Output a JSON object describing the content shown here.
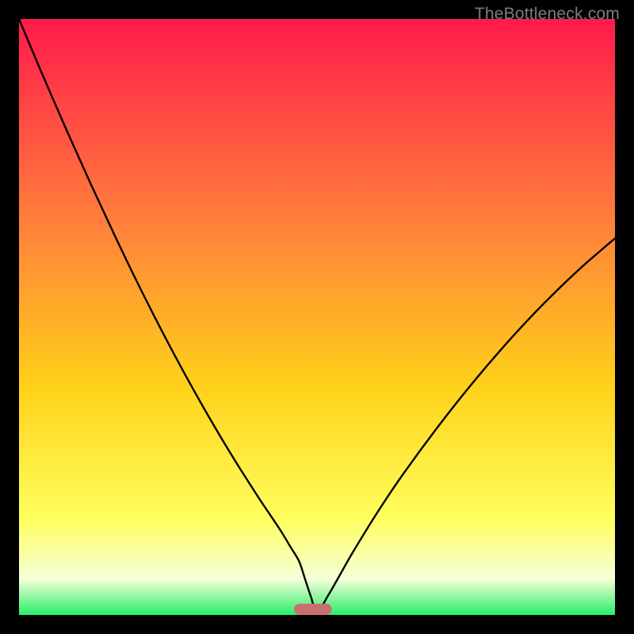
{
  "watermark": "TheBottleneck.com",
  "colors": {
    "gradient_top": "#ff1a4b",
    "gradient_upper_mid": "#ff823a",
    "gradient_mid": "#ffd21a",
    "gradient_lower_mid": "#ffff60",
    "gradient_low": "#f5ffd8",
    "gradient_bottom": "#29ee6a",
    "curve": "#000000",
    "marker_fill": "#c96f6f",
    "frame": "#000000"
  },
  "chart_data": {
    "type": "line",
    "title": "",
    "xlabel": "",
    "ylabel": "",
    "xlim": [
      0,
      100
    ],
    "ylim": [
      0,
      100
    ],
    "grid": false,
    "legend": false,
    "annotations": [],
    "series": [
      {
        "name": "curve",
        "x": [
          0,
          4,
          8,
          12,
          16,
          20,
          24,
          28,
          32,
          36,
          40,
          42,
          44,
          45.5,
          47,
          48,
          49,
          50,
          52,
          54,
          56,
          60,
          64,
          70,
          76,
          82,
          88,
          94,
          100
        ],
        "y": [
          100,
          90.5,
          81.3,
          72.4,
          63.8,
          55.5,
          47.6,
          40.1,
          33.0,
          26.3,
          20.0,
          17.0,
          14.0,
          11.5,
          9.0,
          6.0,
          3.0,
          0.5,
          3.5,
          7.0,
          10.5,
          17.0,
          23.0,
          31.2,
          38.8,
          45.8,
          52.2,
          58.0,
          63.2
        ]
      }
    ],
    "marker": {
      "name": "optimal-marker",
      "x_center": 49.3,
      "width_x": 6.3,
      "height_y": 1.9
    }
  }
}
